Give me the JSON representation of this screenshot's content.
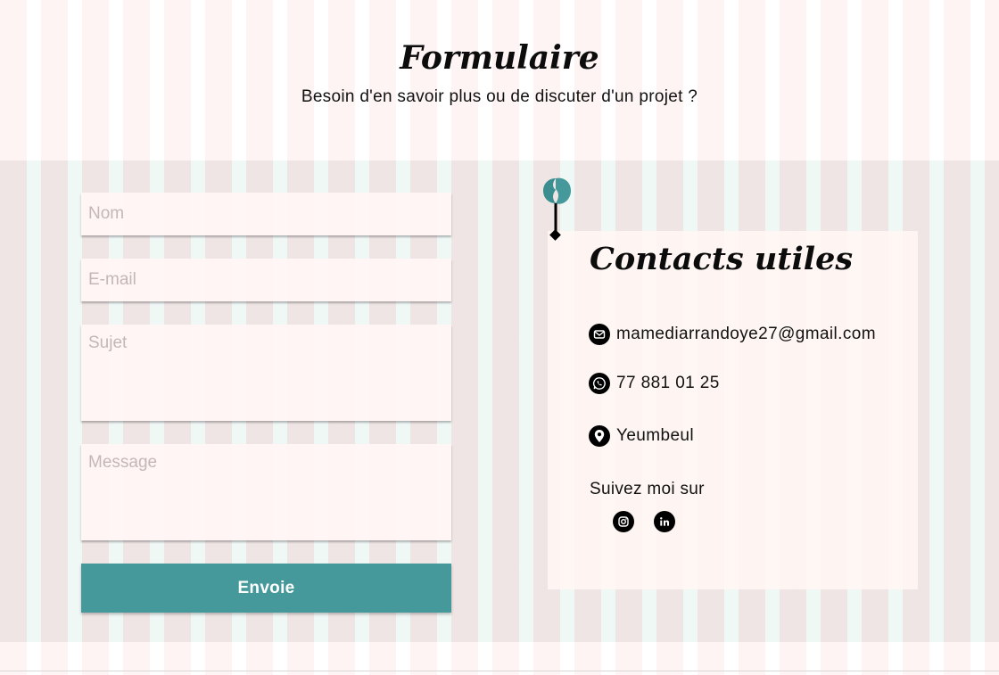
{
  "header": {
    "title": "Formulaire",
    "subtitle": "Besoin d'en savoir plus ou de discuter d'un projet ?"
  },
  "form": {
    "name_placeholder": "Nom",
    "email_placeholder": "E-mail",
    "subject_placeholder": "Sujet",
    "message_placeholder": "Message",
    "submit_label": "Envoie"
  },
  "contacts": {
    "title": "Contacts utiles",
    "email": "mamediarrandoye27@gmail.com",
    "phone": "77 881 01 25",
    "location": "Yeumbeul",
    "follow_label": "Suivez moi sur",
    "social": [
      "instagram-icon",
      "linkedin-icon"
    ]
  },
  "colors": {
    "accent": "#45999a",
    "text": "#111111",
    "field_bg": "#fff6f4"
  }
}
